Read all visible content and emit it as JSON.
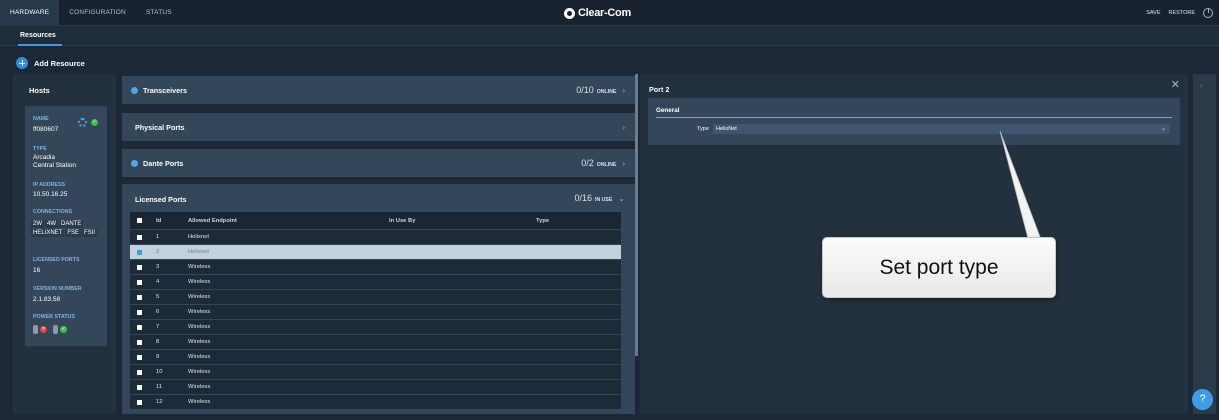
{
  "topnav": {
    "tabs": [
      "HARDWARE",
      "CONFIGURATION",
      "STATUS"
    ],
    "brand": "Clear-Com",
    "save_label": "SAVE",
    "restore_label": "RESTORE"
  },
  "subnav": {
    "tab": "Resources"
  },
  "add_resource": "Add Resource",
  "hosts": {
    "title": "Hosts",
    "card": {
      "name_label": "NAME",
      "name": "ff080607",
      "type_label": "TYPE",
      "type_line1": "Arcadia",
      "type_line2": "Central Station",
      "ip_label": "IP ADDRESS",
      "ip": "10.50.16.25",
      "connections_label": "CONNECTIONS",
      "connections": [
        "2W",
        "4W",
        "DANTE",
        "HELIXNET",
        "FSE",
        "FSII"
      ],
      "licensed_label": "LICENSED PORTS",
      "licensed": "16",
      "version_label": "VERSION NUMBER",
      "version": "2.1.83.58",
      "power_label": "POWER STATUS"
    }
  },
  "panels": {
    "transceivers": {
      "title": "Transceivers",
      "count": "0/10",
      "unit": "ONLINE"
    },
    "physical": {
      "title": "Physical Ports"
    },
    "dante": {
      "title": "Dante Ports",
      "count": "0/2",
      "unit": "ONLINE"
    },
    "licensed": {
      "title": "Licensed Ports",
      "count": "0/16",
      "unit": "IN USE"
    }
  },
  "table": {
    "headers": {
      "id": "Id",
      "endpoint": "Allowed Endpoint",
      "in_use": "In Use By",
      "type": "Type"
    },
    "rows": [
      {
        "id": "1",
        "endpoint": "Helixnet"
      },
      {
        "id": "2",
        "endpoint": "Helixnet"
      },
      {
        "id": "3",
        "endpoint": "Wireless"
      },
      {
        "id": "4",
        "endpoint": "Wireless"
      },
      {
        "id": "5",
        "endpoint": "Wireless"
      },
      {
        "id": "6",
        "endpoint": "Wireless"
      },
      {
        "id": "7",
        "endpoint": "Wireless"
      },
      {
        "id": "8",
        "endpoint": "Wireless"
      },
      {
        "id": "9",
        "endpoint": "Wireless"
      },
      {
        "id": "10",
        "endpoint": "Wireless"
      },
      {
        "id": "11",
        "endpoint": "Wireless"
      },
      {
        "id": "12",
        "endpoint": "Wireless"
      }
    ]
  },
  "detail": {
    "title": "Port 2",
    "section": "General",
    "type_label": "Type",
    "type_value": "HelixNet"
  },
  "help": "?",
  "callout": "Set port type",
  "colors": {
    "accent": "#3d9be9",
    "ok": "#3fbf4e",
    "error": "#e0474c"
  }
}
